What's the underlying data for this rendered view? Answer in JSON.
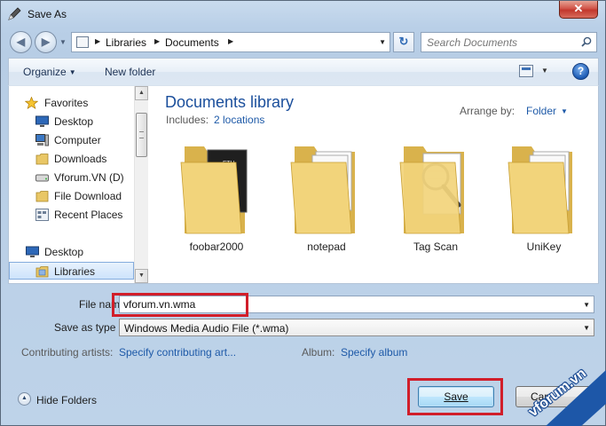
{
  "window": {
    "title": "Save As",
    "close_label": "✕"
  },
  "nav": {
    "back_icon": "back-arrow-icon",
    "forward_icon": "forward-arrow-icon",
    "address_crumbs": [
      "Libraries",
      "Documents"
    ],
    "search_placeholder": "Search Documents"
  },
  "toolbar": {
    "organize_label": "Organize",
    "new_folder_label": "New folder",
    "help_label": "?"
  },
  "sidebar": {
    "items": [
      {
        "label": "Favorites",
        "icon": "star-icon"
      },
      {
        "label": "Desktop",
        "icon": "desktop-icon"
      },
      {
        "label": "Computer",
        "icon": "computer-icon"
      },
      {
        "label": "Downloads",
        "icon": "folder-icon"
      },
      {
        "label": "Vforum.VN (D)",
        "icon": "drive-icon"
      },
      {
        "label": "File Download",
        "icon": "folder-icon"
      },
      {
        "label": "Recent Places",
        "icon": "recent-places-icon"
      },
      {
        "label": "Desktop",
        "icon": "desktop-icon"
      },
      {
        "label": "Libraries",
        "icon": "libraries-icon"
      }
    ]
  },
  "content": {
    "title": "Documents library",
    "includes_label": "Includes:",
    "includes_value": "2 locations",
    "arrange_label": "Arrange by:",
    "arrange_value": "Folder",
    "folders": [
      {
        "name": "foobar2000",
        "overlay": "FTH"
      },
      {
        "name": "notepad",
        "overlay": ""
      },
      {
        "name": "Tag Scan",
        "overlay": ""
      },
      {
        "name": "UniKey",
        "overlay": ""
      }
    ]
  },
  "form": {
    "file_name_label": "File name",
    "file_name_value": "vforum.vn.wma",
    "save_type_label": "Save as type",
    "save_type_value": "Windows Media Audio File (*.wma)",
    "artists_label": "Contributing artists:",
    "artists_link": "Specify contributing art...",
    "album_label": "Album:",
    "album_link": "Specify album"
  },
  "footer": {
    "hide_folders_label": "Hide Folders",
    "save_label": "Save",
    "cancel_label": "Can"
  },
  "watermark": {
    "text": "vforum.vn"
  },
  "colors": {
    "link": "#1e5aa8",
    "highlight": "#d11e2a",
    "title_blue": "#1b4f9c"
  }
}
